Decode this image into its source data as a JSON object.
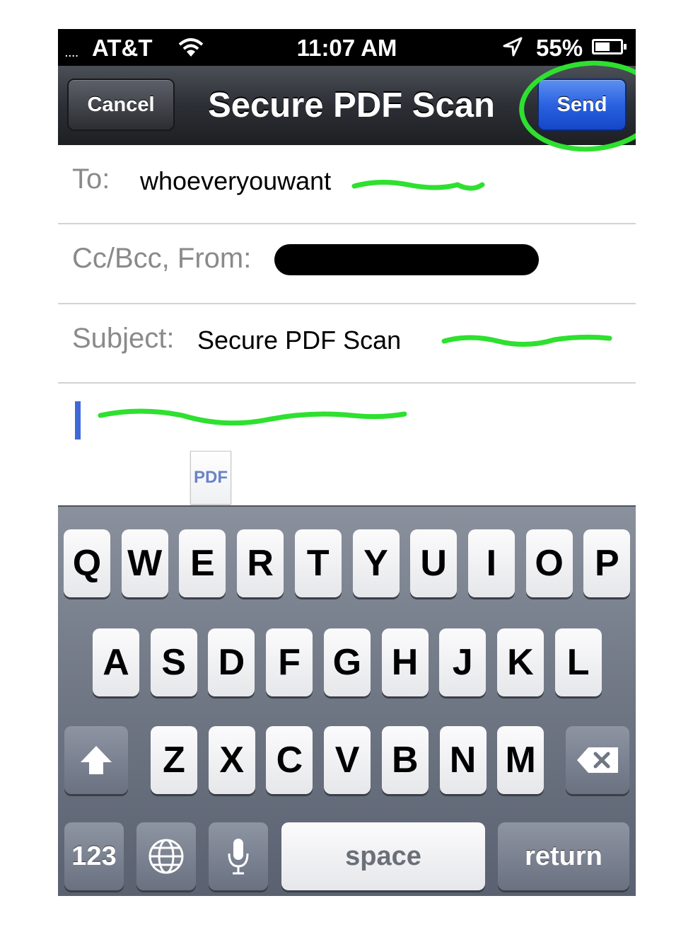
{
  "status_bar": {
    "signal": "....",
    "carrier": "AT&T",
    "time": "11:07 AM",
    "battery": "55%",
    "wifi_icon": "wifi-icon",
    "location_icon": "location-arrow-icon",
    "battery_icon": "battery-icon"
  },
  "nav": {
    "cancel": "Cancel",
    "title": "Secure PDF Scan",
    "send": "Send"
  },
  "fields": {
    "to_label": "To:",
    "to_value": "whoeveryouwant",
    "cc_label": "Cc/Bcc, From:",
    "subject_label": "Subject:",
    "subject_value": "Secure PDF Scan"
  },
  "attachment": {
    "label": "PDF"
  },
  "keyboard": {
    "row1": [
      "Q",
      "W",
      "E",
      "R",
      "T",
      "Y",
      "U",
      "I",
      "O",
      "P"
    ],
    "row2": [
      "A",
      "S",
      "D",
      "F",
      "G",
      "H",
      "J",
      "K",
      "L"
    ],
    "row3": [
      "Z",
      "X",
      "C",
      "V",
      "B",
      "N",
      "M"
    ],
    "numbers": "123",
    "space": "space",
    "return": "return",
    "shift_icon": "shift-arrow-icon",
    "delete_icon": "backspace-icon",
    "globe_icon": "globe-icon",
    "mic_icon": "microphone-icon"
  },
  "annotation_colors": {
    "highlight": "#2ee02f",
    "send_button": "#2a62e0",
    "redaction": "#000000"
  }
}
